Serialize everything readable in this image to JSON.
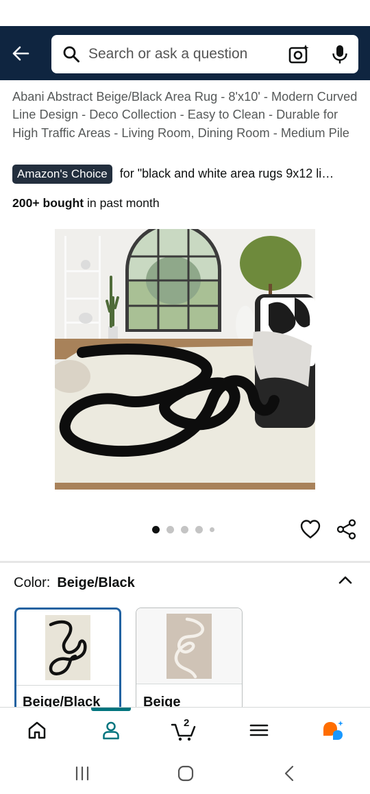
{
  "search": {
    "placeholder": "Search or ask a question",
    "icons": [
      "back-arrow-icon",
      "search-icon",
      "camera-icon",
      "mic-icon"
    ]
  },
  "product": {
    "title": "Abani Abstract Beige/Black Area Rug - 8'x10' - Modern Curved Line Design - Deco Collection - Easy to Clean - Durable for High Traffic Areas - Living Room, Dining Room - Medium Pile",
    "badge": "Amazon's Choice",
    "badge_for": "for \"black and white area rugs 9x12 li…",
    "bought_count": "200+ bought",
    "bought_suffix": " in past month",
    "image_count": 5,
    "active_image": 1
  },
  "variation": {
    "label": "Color:",
    "selected": "Beige/Black",
    "options": [
      {
        "name": "Beige/Black",
        "selected": true
      },
      {
        "name": "Beige",
        "selected": false
      }
    ]
  },
  "bottom_nav": {
    "items": [
      "home-icon",
      "account-icon",
      "cart-icon",
      "menu-icon",
      "rufus-icon"
    ],
    "active": "account-icon",
    "cart_count": "2"
  },
  "colors": {
    "header_bg": "#0f2540",
    "badge_bg": "#232f3e",
    "selected_border": "#2162a1",
    "nav_indicator": "#00747e",
    "rufus_orange": "#ff6d00",
    "rufus_blue": "#1a98ff"
  }
}
